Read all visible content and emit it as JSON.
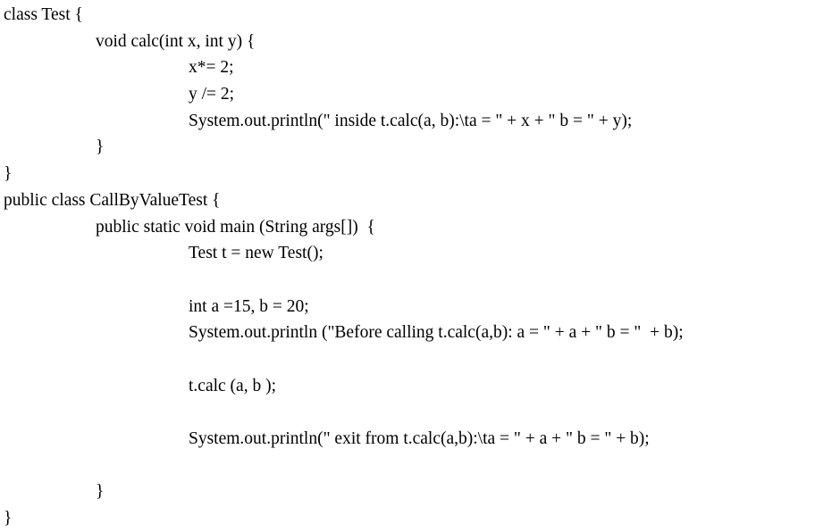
{
  "document": {
    "kind": "java-source-code-listing",
    "background_color": "#ffffff",
    "text_color": "#000000",
    "lines": [
      {
        "indent": 0,
        "text": "class Test {"
      },
      {
        "indent": 1,
        "text": "void calc(int x, int y) {"
      },
      {
        "indent": 2,
        "text": "x*= 2;"
      },
      {
        "indent": 2,
        "text": "y /= 2;"
      },
      {
        "indent": 2,
        "text": "System.out.println(\" inside t.calc(a, b):\\ta = \" + x + \" b = \" + y);"
      },
      {
        "indent": 1,
        "text": "}"
      },
      {
        "indent": 0,
        "text": "}"
      },
      {
        "indent": 0,
        "text": "public class CallByValueTest {"
      },
      {
        "indent": 1,
        "text": "public static void main (String args[])  {"
      },
      {
        "indent": 2,
        "text": "Test t = new Test();"
      },
      {
        "indent": 2,
        "text": ""
      },
      {
        "indent": 2,
        "text": "int a =15, b = 20;"
      },
      {
        "indent": 2,
        "text": "System.out.println (\"Before calling t.calc(a,b): a = \" + a + \" b = \"  + b);"
      },
      {
        "indent": 2,
        "text": ""
      },
      {
        "indent": 2,
        "text": "t.calc (a, b );"
      },
      {
        "indent": 2,
        "text": ""
      },
      {
        "indent": 2,
        "text": "System.out.println(\" exit from t.calc(a,b):\\ta = \" + a + \" b = \" + b);"
      },
      {
        "indent": 2,
        "text": ""
      },
      {
        "indent": 1,
        "text": "}"
      },
      {
        "indent": 0,
        "text": "}"
      }
    ]
  }
}
